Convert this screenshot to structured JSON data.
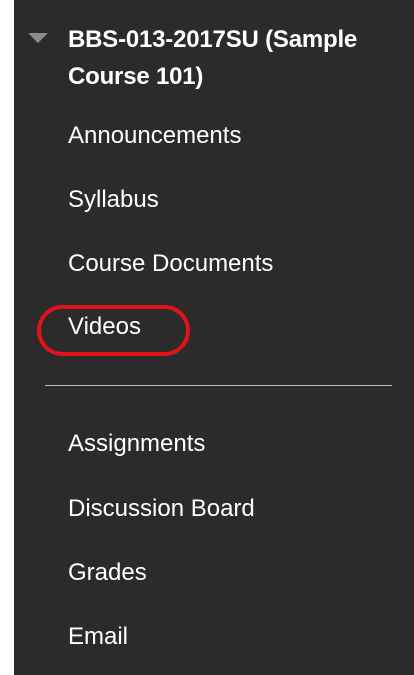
{
  "course": {
    "title": "BBS-013-2017SU (Sample Course 101)"
  },
  "menu": {
    "group1": [
      {
        "label": "Announcements"
      },
      {
        "label": "Syllabus"
      },
      {
        "label": "Course Documents"
      },
      {
        "label": "Videos"
      }
    ],
    "group2": [
      {
        "label": "Assignments"
      },
      {
        "label": "Discussion Board"
      },
      {
        "label": "Grades"
      },
      {
        "label": "Email"
      }
    ]
  },
  "colors": {
    "panel_background": "#2b2b2b",
    "text": "#ffffff",
    "highlight": "#e0131b",
    "divider": "#bdbdbd",
    "collapse_icon": "#8c8c8c"
  },
  "icons": {
    "collapse": "triangle-down-icon"
  },
  "highlighted_item": "Videos"
}
